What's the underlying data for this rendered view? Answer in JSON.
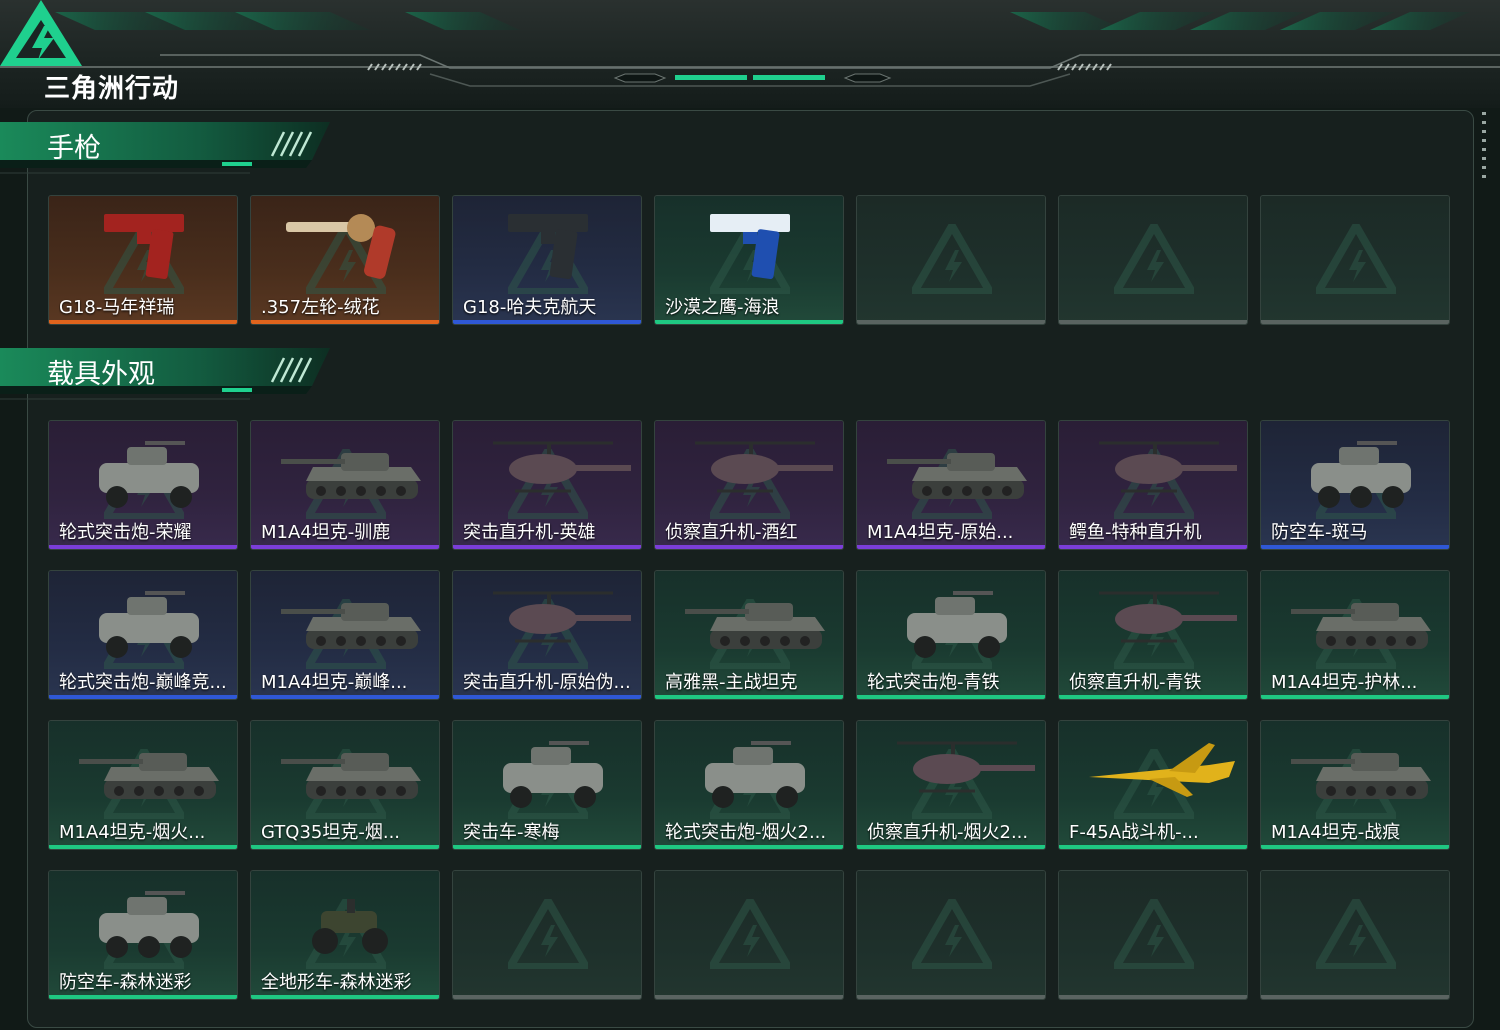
{
  "app": {
    "logo_text": "三角洲行动",
    "logo_icon": "delta-triangle-icon"
  },
  "colors": {
    "orange": "#e0641d",
    "blue": "#2f58d6",
    "purple": "#7b3ed8",
    "green": "#1fc882",
    "accent": "#1fd08e"
  },
  "sections": [
    {
      "title": "手枪",
      "items": [
        {
          "label": "G18-马年祥瑞",
          "rarity": "orange",
          "icon": "pistol-red-icon"
        },
        {
          "label": ".357左轮-绒花",
          "rarity": "orange",
          "icon": "revolver-icon"
        },
        {
          "label": "G18-哈夫克航天",
          "rarity": "blue",
          "icon": "pistol-black-icon"
        },
        {
          "label": "沙漠之鹰-海浪",
          "rarity": "green",
          "icon": "pistol-blue-icon"
        },
        {
          "label": "",
          "rarity": "empty",
          "icon": "empty-slot-icon"
        },
        {
          "label": "",
          "rarity": "empty",
          "icon": "empty-slot-icon"
        },
        {
          "label": "",
          "rarity": "empty",
          "icon": "empty-slot-icon"
        }
      ]
    },
    {
      "title": "载具外观",
      "items": [
        {
          "label": "轮式突击炮-荣耀",
          "rarity": "purple",
          "icon": "armored-car-icon"
        },
        {
          "label": "M1A4坦克-驯鹿",
          "rarity": "purple",
          "icon": "tank-icon"
        },
        {
          "label": "突击直升机-英雄",
          "rarity": "purple",
          "icon": "attack-helicopter-icon"
        },
        {
          "label": "侦察直升机-酒红",
          "rarity": "purple",
          "icon": "scout-helicopter-icon"
        },
        {
          "label": "M1A4坦克-原始...",
          "rarity": "purple",
          "icon": "tank-icon"
        },
        {
          "label": "鳄鱼-特种直升机",
          "rarity": "purple",
          "icon": "attack-helicopter-icon"
        },
        {
          "label": "防空车-斑马",
          "rarity": "blue",
          "icon": "aa-vehicle-icon"
        },
        {
          "label": "轮式突击炮-巅峰竞...",
          "rarity": "blue",
          "icon": "armored-car-icon"
        },
        {
          "label": "M1A4坦克-巅峰...",
          "rarity": "blue",
          "icon": "tank-icon"
        },
        {
          "label": "突击直升机-原始伪...",
          "rarity": "blue",
          "icon": "attack-helicopter-icon"
        },
        {
          "label": "高雅黑-主战坦克",
          "rarity": "green",
          "icon": "tank-icon"
        },
        {
          "label": "轮式突击炮-青铁",
          "rarity": "green",
          "icon": "armored-car-icon"
        },
        {
          "label": "侦察直升机-青铁",
          "rarity": "green",
          "icon": "scout-helicopter-icon"
        },
        {
          "label": "M1A4坦克-护林...",
          "rarity": "green",
          "icon": "tank-icon"
        },
        {
          "label": "M1A4坦克-烟火...",
          "rarity": "green",
          "icon": "tank-icon"
        },
        {
          "label": "GTQ35坦克-烟...",
          "rarity": "green",
          "icon": "tank-icon"
        },
        {
          "label": "突击车-寒梅",
          "rarity": "green",
          "icon": "assault-vehicle-icon"
        },
        {
          "label": "轮式突击炮-烟火2...",
          "rarity": "green",
          "icon": "armored-car-icon"
        },
        {
          "label": "侦察直升机-烟火2...",
          "rarity": "green",
          "icon": "scout-helicopter-icon"
        },
        {
          "label": "F-45A战斗机-...",
          "rarity": "green",
          "icon": "fighter-jet-icon"
        },
        {
          "label": "M1A4坦克-战痕",
          "rarity": "green",
          "icon": "tank-icon"
        },
        {
          "label": "防空车-森林迷彩",
          "rarity": "green",
          "icon": "aa-vehicle-icon"
        },
        {
          "label": "全地形车-森林迷彩",
          "rarity": "green",
          "icon": "atv-icon"
        },
        {
          "label": "",
          "rarity": "empty",
          "icon": "empty-slot-icon"
        },
        {
          "label": "",
          "rarity": "empty",
          "icon": "empty-slot-icon"
        },
        {
          "label": "",
          "rarity": "empty",
          "icon": "empty-slot-icon"
        },
        {
          "label": "",
          "rarity": "empty",
          "icon": "empty-slot-icon"
        },
        {
          "label": "",
          "rarity": "empty",
          "icon": "empty-slot-icon"
        }
      ]
    }
  ]
}
